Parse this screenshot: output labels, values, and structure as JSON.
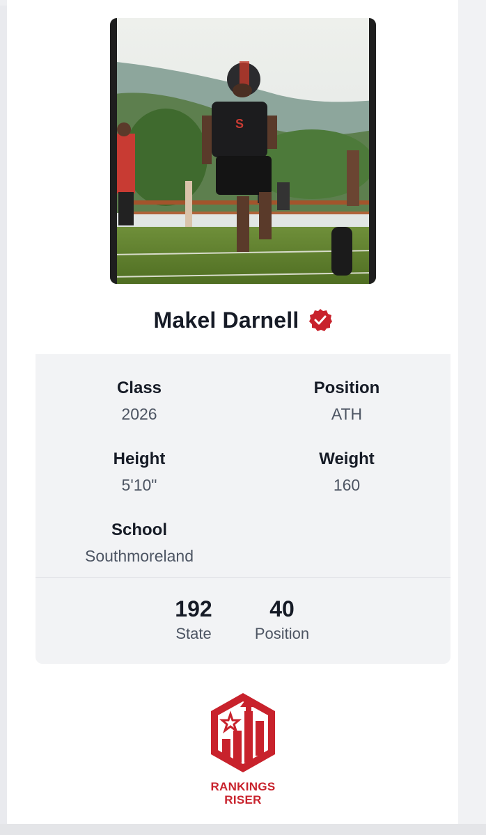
{
  "player": {
    "name": "Makel Darnell",
    "photo_alt": "Makel Darnell football photo"
  },
  "details": {
    "class_label": "Class",
    "class_value": "2026",
    "position_label": "Position",
    "position_value": "ATH",
    "height_label": "Height",
    "height_value": "5'10\"",
    "weight_label": "Weight",
    "weight_value": "160",
    "school_label": "School",
    "school_value": "Southmoreland"
  },
  "rankings": {
    "state_number": "192",
    "state_label": "State",
    "position_number": "40",
    "position_label": "Position"
  },
  "logo": {
    "line1": "RANKINGS",
    "line2": "RISER"
  },
  "colors": {
    "accent": "#c8222c",
    "text_dark": "#161b26",
    "text_muted": "#4d5563",
    "panel": "#f2f3f5"
  }
}
